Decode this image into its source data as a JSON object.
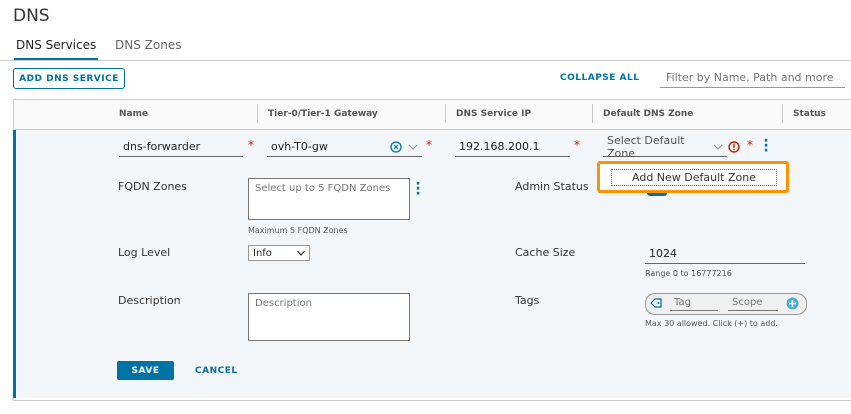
{
  "page": {
    "title": "DNS"
  },
  "tabs": [
    {
      "label": "DNS Services",
      "active": true
    },
    {
      "label": "DNS Zones",
      "active": false
    }
  ],
  "toolbar": {
    "add_label": "ADD DNS SERVICE",
    "collapse_label": "COLLAPSE ALL",
    "filter_placeholder": "Filter by Name, Path and more"
  },
  "columns": [
    "Name",
    "Tier-0/Tier-1 Gateway",
    "DNS Service IP",
    "Default DNS Zone",
    "Status"
  ],
  "row": {
    "name": "dns-forwarder",
    "gateway": "ovh-T0-gw",
    "service_ip": "192.168.200.1",
    "default_zone_placeholder": "Select Default Zone",
    "required_mark": "*"
  },
  "form": {
    "fqdn_label": "FQDN Zones",
    "fqdn_placeholder": "Select up to 5 FQDN Zones",
    "fqdn_hint": "Maximum 5 FQDN Zones",
    "admin_status_label": "Admin Status",
    "log_level_label": "Log Level",
    "log_level_value": "Info",
    "cache_size_label": "Cache Size",
    "cache_size_value": "1024",
    "cache_size_hint": "Range 0 to 16777216",
    "description_label": "Description",
    "description_placeholder": "Description",
    "tags_label": "Tags",
    "tag_placeholder": "Tag",
    "scope_placeholder": "Scope",
    "tags_hint": "Max 30 allowed. Click (+) to add.",
    "save_label": "SAVE",
    "cancel_label": "CANCEL"
  },
  "popup": {
    "item_label": "Add New Default Zone"
  },
  "colors": {
    "accent": "#0072a3",
    "highlight": "#f89406",
    "error": "#c92100"
  }
}
